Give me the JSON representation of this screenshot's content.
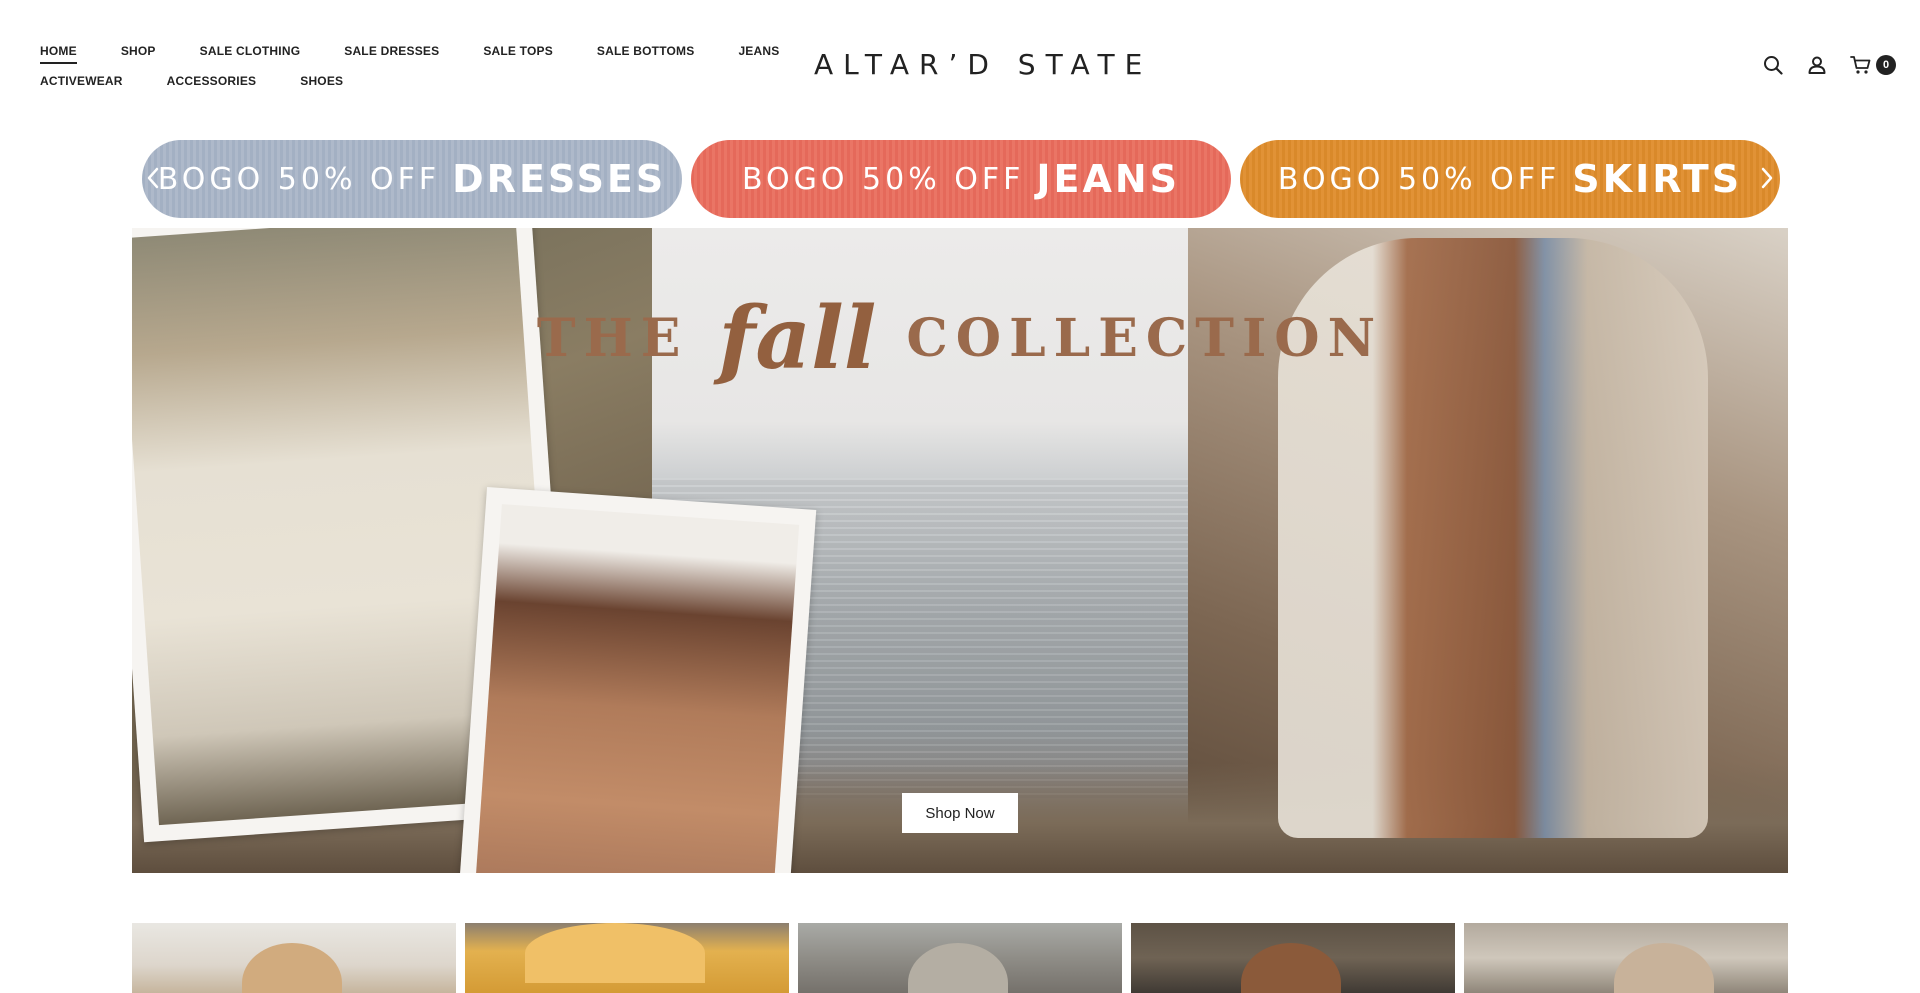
{
  "nav": {
    "row1": [
      {
        "label": "HOME",
        "active": true
      },
      {
        "label": "SHOP"
      },
      {
        "label": "SALE CLOTHING"
      },
      {
        "label": "SALE DRESSES"
      },
      {
        "label": "SALE TOPS"
      },
      {
        "label": "SALE BOTTOMS"
      },
      {
        "label": "JEANS"
      }
    ],
    "row2": [
      {
        "label": "ACTIVEWEAR"
      },
      {
        "label": "ACCESSORIES"
      },
      {
        "label": "SHOES"
      }
    ]
  },
  "brand": {
    "logo_text": "ALTAR’D STATE"
  },
  "header_icons": {
    "search": "search-icon",
    "account": "user-icon",
    "cart": "cart-icon",
    "cart_count": "0"
  },
  "promo": {
    "items": [
      {
        "lead": "BOGO 50% OFF",
        "strong": "DRESSES",
        "color": "#a8b4c6"
      },
      {
        "lead": "BOGO 50% OFF",
        "strong": "JEANS",
        "color": "#e76f60"
      },
      {
        "lead": "BOGO 50% OFF",
        "strong": "SKIRTS",
        "color": "#dc8d30"
      }
    ],
    "prev_icon": "chevron-left-icon",
    "next_icon": "chevron-right-icon"
  },
  "hero": {
    "title_part1": "THE",
    "title_part2": "fall",
    "title_part3": "COLLECTION",
    "cta_label": "Shop Now",
    "accent_color": "#9a6a4c"
  }
}
